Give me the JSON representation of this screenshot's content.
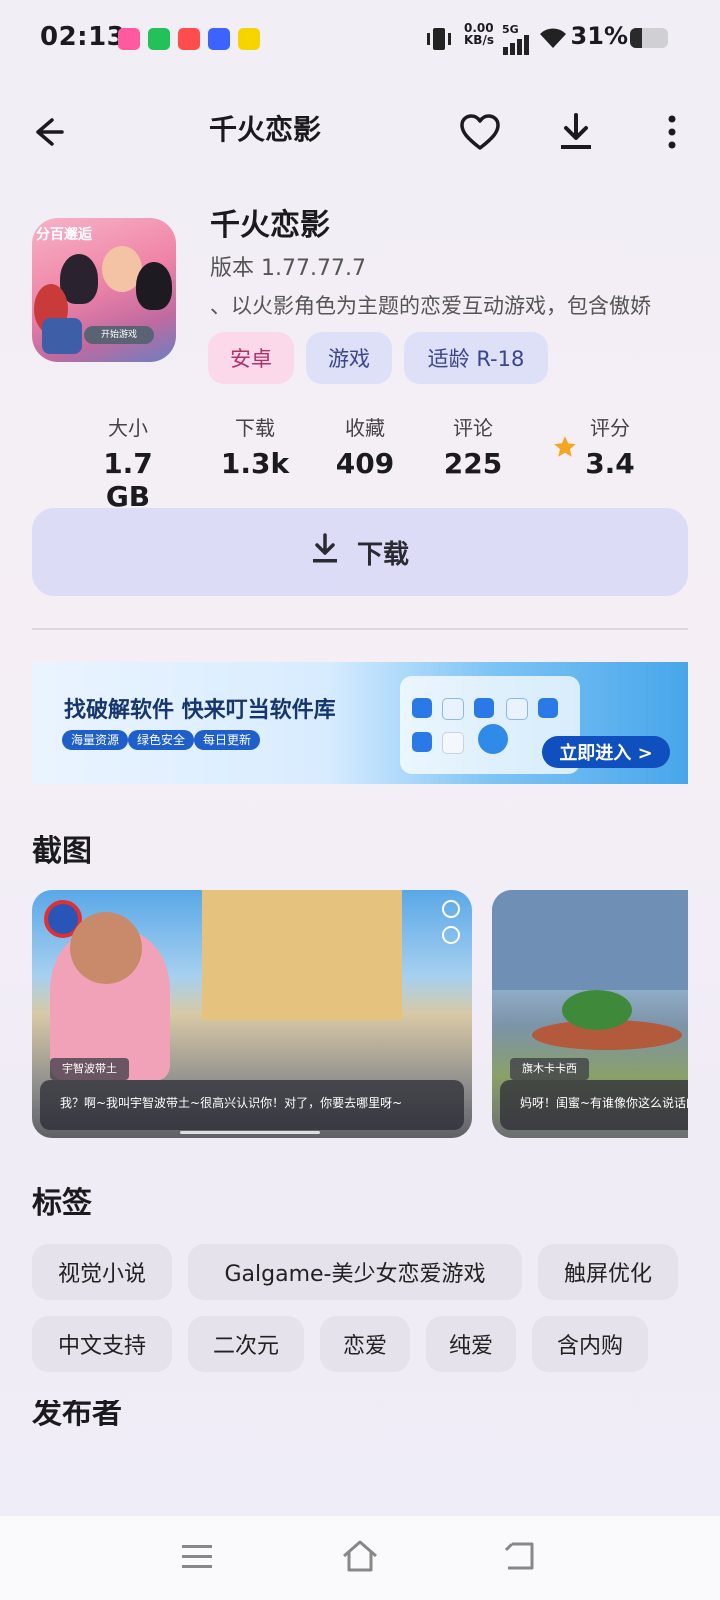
{
  "status_bar": {
    "time": "02:13",
    "net_speed_value": "0.00",
    "net_speed_unit": "KB/s",
    "network": "5G",
    "battery": "31%",
    "battery_level": 0.31
  },
  "top_bar": {
    "title": "千火恋影",
    "icons": [
      "back-arrow-icon",
      "heart-icon",
      "download-icon",
      "more-vertical-icon"
    ]
  },
  "app": {
    "name": "千火恋影",
    "version": "版本 1.77.77.7",
    "description": "以火影角色为主题的恋爱互动游戏，包含傲娇、",
    "icon_caption": "分百邂逅",
    "icon_button": "开始游戏",
    "chips": [
      "安卓",
      "游戏",
      "适龄 R-18"
    ]
  },
  "stats": [
    {
      "label": "大小",
      "value": "1.7 GB"
    },
    {
      "label": "下载",
      "value": "1.3k"
    },
    {
      "label": "收藏",
      "value": "409"
    },
    {
      "label": "评论",
      "value": "225"
    },
    {
      "label": "评分",
      "value": "3.4"
    }
  ],
  "download_button": {
    "label": "下载"
  },
  "banner": {
    "title": "找破解软件 快来叮当软件库",
    "pills": [
      "海量资源",
      "绿色安全",
      "每日更新"
    ],
    "cta": "立即进入 >"
  },
  "screenshots_section": {
    "title": "截图",
    "shots": [
      {
        "speaker": "宇智波带土",
        "line": "我？啊~我叫宇智波带土~很高兴认识你！对了，你要去哪里呀~"
      },
      {
        "speaker": "旗木卡卡西",
        "line": "妈呀！闺蜜~有谁像你这么说话的"
      }
    ]
  },
  "tags_section": {
    "title": "标签",
    "tags": [
      "视觉小说",
      "Galgame-美少女恋爱游戏",
      "触屏优化",
      "中文支持",
      "二次元",
      "恋爱",
      "纯爱",
      "含内购"
    ]
  },
  "next_section": {
    "title": "发布者"
  },
  "nav_bar": {
    "icons": [
      "menu-icon",
      "home-icon",
      "back-icon"
    ]
  },
  "colors": {
    "chip_pink": "#fbd9ea",
    "chip_lavender": "#dde0f6",
    "download_bg": "#dcdcf6",
    "star": "#f5a623",
    "tag_bg": "#e6e2ec"
  }
}
